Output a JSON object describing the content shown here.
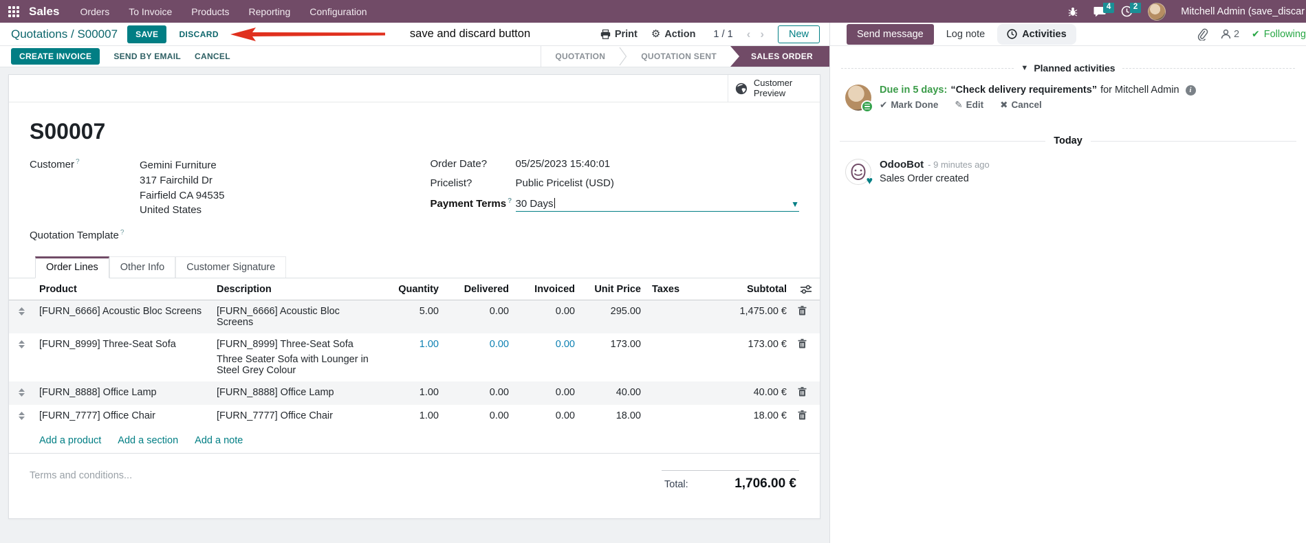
{
  "colors": {
    "brand_purple": "#714B67",
    "accent_teal": "#017E84",
    "success_green": "#28a745",
    "annotation_red": "#e0301e",
    "dirty_cell_blue": "#0d80b2"
  },
  "topbar": {
    "brand": "Sales",
    "menus": [
      "Orders",
      "To Invoice",
      "Products",
      "Reporting",
      "Configuration"
    ],
    "message_badge": "4",
    "activity_badge": "2",
    "user_name": "Mitchell Admin (save_discar"
  },
  "control_panel": {
    "breadcrumb_parent": "Quotations",
    "breadcrumb_separator": "/",
    "breadcrumb_current": "S00007",
    "save_label": "SAVE",
    "discard_label": "DISCARD",
    "annotation_text": "save and discard button",
    "print_label": "Print",
    "action_label": "Action",
    "pager": "1 / 1",
    "prev_arrow": "‹",
    "next_arrow": "›",
    "new_label": "New"
  },
  "form_header": {
    "buttons": [
      "CREATE INVOICE",
      "SEND BY EMAIL",
      "CANCEL"
    ],
    "statusbar": {
      "steps": [
        "QUOTATION",
        "QUOTATION SENT",
        "SALES ORDER"
      ],
      "active_step": "SALES ORDER"
    }
  },
  "sheet": {
    "preview_button": "Customer Preview",
    "title": "S00007",
    "fields": {
      "customer_label": "Customer",
      "customer_name": "Gemini Furniture",
      "customer_address": [
        "317 Fairchild Dr",
        "Fairfield CA 94535",
        "United States"
      ],
      "quotation_template_label": "Quotation Template",
      "order_date_label": "Order Date",
      "order_date_value": "05/25/2023 15:40:01",
      "pricelist_label": "Pricelist",
      "pricelist_value": "Public Pricelist (USD)",
      "payment_terms_label": "Payment Terms",
      "payment_terms_value": "30 Days",
      "help_mark": "?"
    },
    "tabs": [
      "Order Lines",
      "Other Info",
      "Customer Signature"
    ],
    "order_lines": {
      "columns": {
        "product": "Product",
        "description": "Description",
        "quantity": "Quantity",
        "delivered": "Delivered",
        "invoiced": "Invoiced",
        "unit_price": "Unit Price",
        "taxes": "Taxes",
        "subtotal": "Subtotal"
      },
      "rows": [
        {
          "product": "[FURN_6666] Acoustic Bloc Screens",
          "description": "[FURN_6666] Acoustic Bloc Screens",
          "description2": "",
          "quantity": "5.00",
          "delivered": "0.00",
          "invoiced": "0.00",
          "unit_price": "295.00",
          "subtotal": "1,475.00 €"
        },
        {
          "product": "[FURN_8999] Three-Seat Sofa",
          "description": "[FURN_8999] Three-Seat Sofa",
          "description2": "Three Seater Sofa with Lounger in Steel Grey Colour",
          "quantity": "1.00",
          "delivered": "0.00",
          "invoiced": "0.00",
          "unit_price": "173.00",
          "subtotal": "173.00 €"
        },
        {
          "product": "[FURN_8888] Office Lamp",
          "description": "[FURN_8888] Office Lamp",
          "description2": "",
          "quantity": "1.00",
          "delivered": "0.00",
          "invoiced": "0.00",
          "unit_price": "40.00",
          "subtotal": "40.00 €"
        },
        {
          "product": "[FURN_7777] Office Chair",
          "description": "[FURN_7777] Office Chair",
          "description2": "",
          "quantity": "1.00",
          "delivered": "0.00",
          "invoiced": "0.00",
          "unit_price": "18.00",
          "subtotal": "18.00 €"
        }
      ],
      "add_links": [
        "Add a product",
        "Add a section",
        "Add a note"
      ]
    },
    "terms_placeholder": "Terms and conditions...",
    "total_label": "Total:",
    "total_value": "1,706.00 €"
  },
  "chatter": {
    "send_message_label": "Send message",
    "log_note_label": "Log note",
    "activities_label": "Activities",
    "followers_count": "2",
    "following_label": "Following",
    "planned_activities_title": "Planned activities",
    "activity": {
      "due_text": "Due in 5 days:",
      "summary": "“Check delivery requirements”",
      "assignee_text": "for Mitchell Admin",
      "mark_done_label": "Mark Done",
      "edit_label": "Edit",
      "cancel_label": "Cancel"
    },
    "today_label": "Today",
    "message": {
      "author": "OdooBot",
      "time": "- 9 minutes ago",
      "body": "Sales Order created"
    }
  }
}
